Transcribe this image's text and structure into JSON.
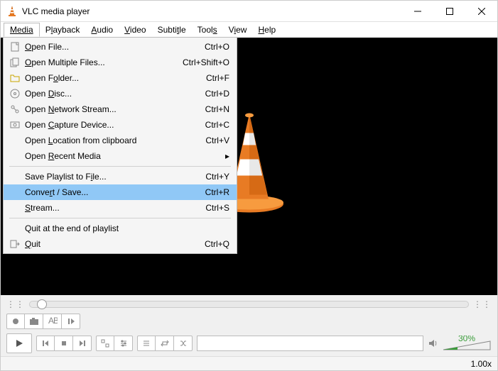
{
  "window": {
    "title": "VLC media player"
  },
  "menubar": {
    "media": "Media",
    "playback": "Playback",
    "audio": "Audio",
    "video": "Video",
    "subtitle": "Subtitle",
    "tools": "Tools",
    "view": "View",
    "help": "Help"
  },
  "media_menu": {
    "open_file": {
      "label": "Open File...",
      "shortcut": "Ctrl+O"
    },
    "open_multiple": {
      "label": "Open Multiple Files...",
      "shortcut": "Ctrl+Shift+O"
    },
    "open_folder": {
      "label": "Open Folder...",
      "shortcut": "Ctrl+F"
    },
    "open_disc": {
      "label": "Open Disc...",
      "shortcut": "Ctrl+D"
    },
    "open_network": {
      "label": "Open Network Stream...",
      "shortcut": "Ctrl+N"
    },
    "open_capture": {
      "label": "Open Capture Device...",
      "shortcut": "Ctrl+C"
    },
    "open_clipboard": {
      "label": "Open Location from clipboard",
      "shortcut": "Ctrl+V"
    },
    "open_recent": {
      "label": "Open Recent Media"
    },
    "save_playlist": {
      "label": "Save Playlist to File...",
      "shortcut": "Ctrl+Y"
    },
    "convert": {
      "label": "Convert / Save...",
      "shortcut": "Ctrl+R"
    },
    "stream": {
      "label": "Stream...",
      "shortcut": "Ctrl+S"
    },
    "quit_end": {
      "label": "Quit at the end of playlist"
    },
    "quit": {
      "label": "Quit",
      "shortcut": "Ctrl+Q"
    }
  },
  "volume": {
    "percent": "30%"
  },
  "status": {
    "speed": "1.00x"
  }
}
